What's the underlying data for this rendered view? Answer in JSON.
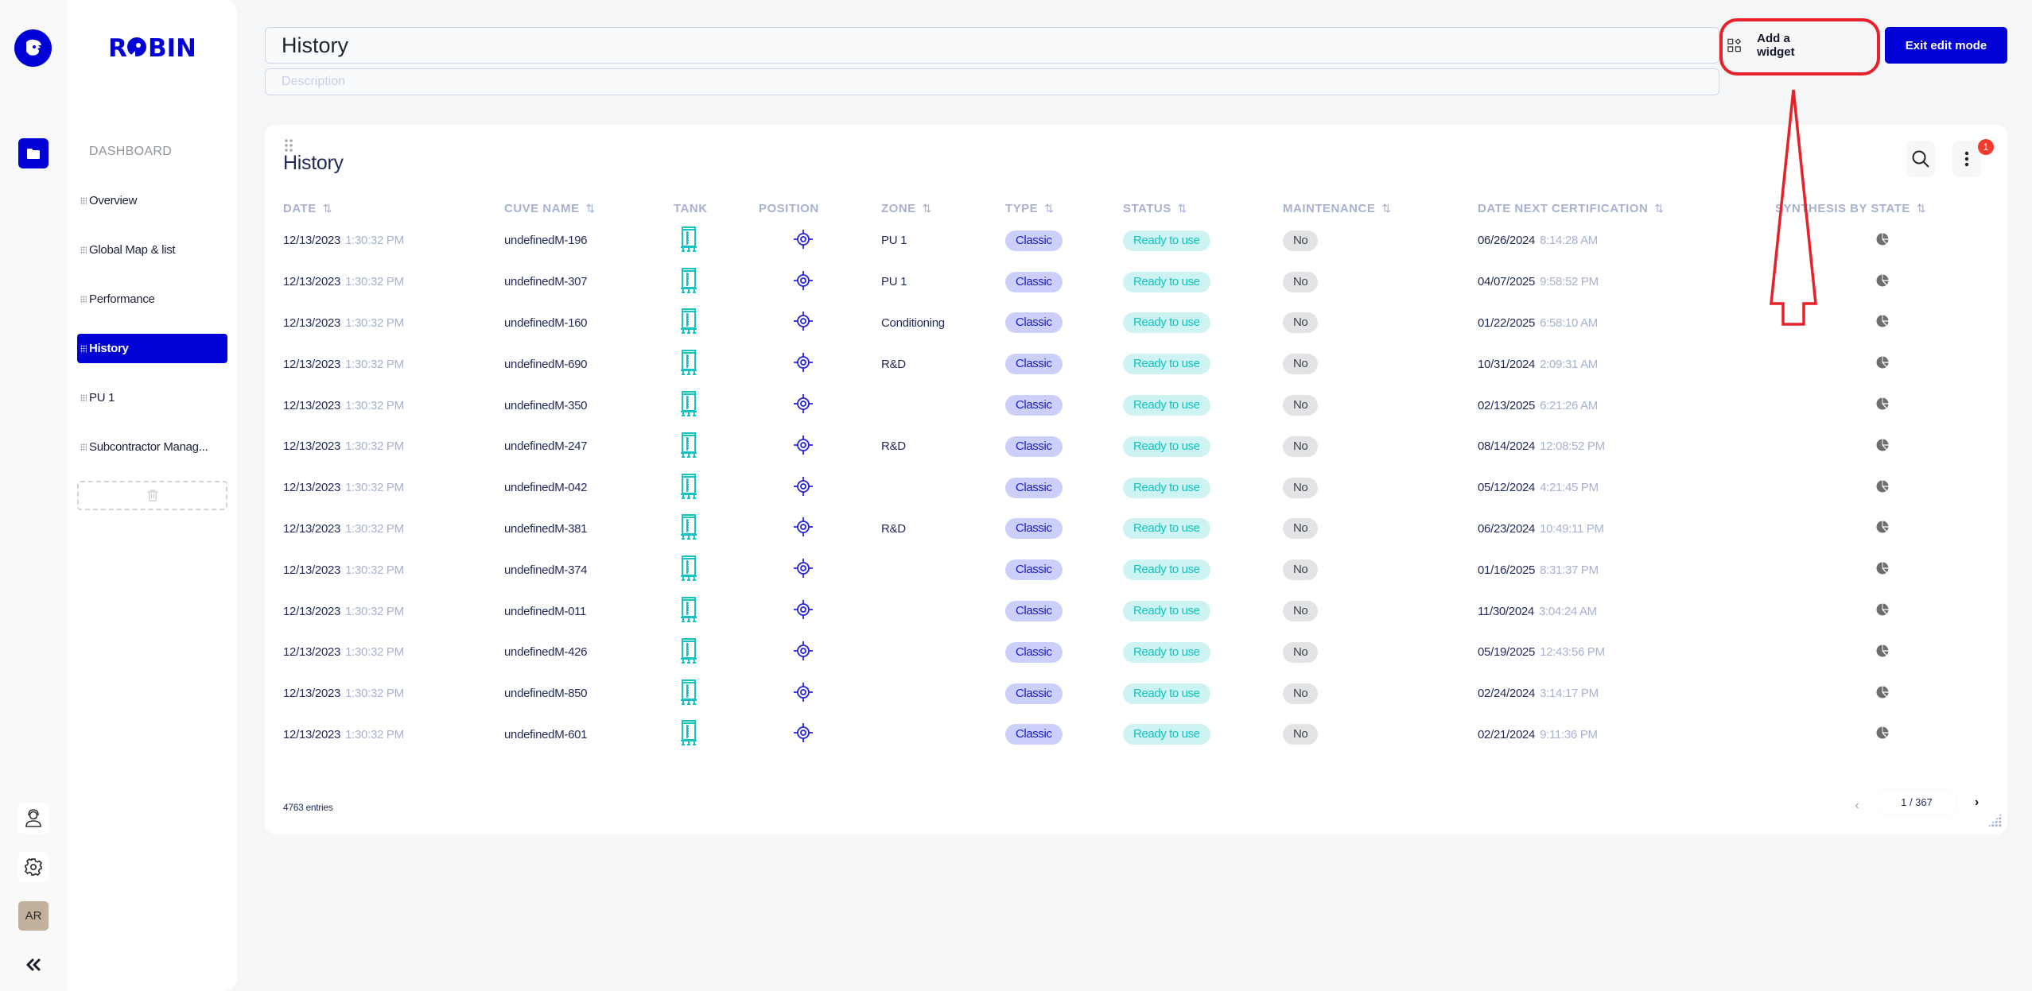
{
  "app": {
    "brand": "RCBIN",
    "brand_display": "R◐BIN",
    "section_label": "DASHBOARD",
    "avatar_initials": "AR",
    "colors": {
      "primary": "#0202d6",
      "teal": "#12c3c0",
      "alert": "#f43a2f",
      "annotation": "#e8202a"
    }
  },
  "rail": {
    "icons": [
      "robin-logo-icon",
      "folder-icon",
      "support-headset-icon",
      "gear-icon",
      "collapse-double-chevron-icon"
    ]
  },
  "nav": {
    "items": [
      {
        "label": "Overview",
        "active": false
      },
      {
        "label": "Global Map & list",
        "active": false
      },
      {
        "label": "Performance",
        "active": false
      },
      {
        "label": "History",
        "active": true
      },
      {
        "label": "PU 1",
        "active": false
      },
      {
        "label": "Subcontractor Manag...",
        "active": false
      }
    ],
    "drop_zone_icon": "trash-icon"
  },
  "header": {
    "title_value": "History",
    "description_placeholder": "Description",
    "add_widget_label": "Add a widget",
    "exit_edit_label": "Exit edit mode"
  },
  "widget": {
    "title": "History",
    "notification_count": "1",
    "columns": [
      {
        "label": "DATE",
        "sortable": true
      },
      {
        "label": "CUVE NAME",
        "sortable": true
      },
      {
        "label": "TANK",
        "sortable": false
      },
      {
        "label": "POSITION",
        "sortable": false
      },
      {
        "label": "ZONE",
        "sortable": true
      },
      {
        "label": "TYPE",
        "sortable": true
      },
      {
        "label": "STATUS",
        "sortable": true
      },
      {
        "label": "MAINTENANCE",
        "sortable": true
      },
      {
        "label": "DATE NEXT CERTIFICATION",
        "sortable": true
      },
      {
        "label": "SYNTHESIS BY STATE",
        "sortable": true
      }
    ],
    "sort_glyph": "⇅",
    "rows": [
      {
        "date": "12/13/2023",
        "time": "1:30:32 PM",
        "name": "undefinedM-196",
        "zone": "PU 1",
        "type": "Classic",
        "status": "Ready to use",
        "maintenance": "No",
        "cert_date": "06/26/2024",
        "cert_time": "8:14:28 AM"
      },
      {
        "date": "12/13/2023",
        "time": "1:30:32 PM",
        "name": "undefinedM-307",
        "zone": "PU 1",
        "type": "Classic",
        "status": "Ready to use",
        "maintenance": "No",
        "cert_date": "04/07/2025",
        "cert_time": "9:58:52 PM"
      },
      {
        "date": "12/13/2023",
        "time": "1:30:32 PM",
        "name": "undefinedM-160",
        "zone": "Conditioning",
        "type": "Classic",
        "status": "Ready to use",
        "maintenance": "No",
        "cert_date": "01/22/2025",
        "cert_time": "6:58:10 AM"
      },
      {
        "date": "12/13/2023",
        "time": "1:30:32 PM",
        "name": "undefinedM-690",
        "zone": "R&D",
        "type": "Classic",
        "status": "Ready to use",
        "maintenance": "No",
        "cert_date": "10/31/2024",
        "cert_time": "2:09:31 AM"
      },
      {
        "date": "12/13/2023",
        "time": "1:30:32 PM",
        "name": "undefinedM-350",
        "zone": "",
        "type": "Classic",
        "status": "Ready to use",
        "maintenance": "No",
        "cert_date": "02/13/2025",
        "cert_time": "6:21:26 AM"
      },
      {
        "date": "12/13/2023",
        "time": "1:30:32 PM",
        "name": "undefinedM-247",
        "zone": "R&D",
        "type": "Classic",
        "status": "Ready to use",
        "maintenance": "No",
        "cert_date": "08/14/2024",
        "cert_time": "12:08:52 PM"
      },
      {
        "date": "12/13/2023",
        "time": "1:30:32 PM",
        "name": "undefinedM-042",
        "zone": "",
        "type": "Classic",
        "status": "Ready to use",
        "maintenance": "No",
        "cert_date": "05/12/2024",
        "cert_time": "4:21:45 PM"
      },
      {
        "date": "12/13/2023",
        "time": "1:30:32 PM",
        "name": "undefinedM-381",
        "zone": "R&D",
        "type": "Classic",
        "status": "Ready to use",
        "maintenance": "No",
        "cert_date": "06/23/2024",
        "cert_time": "10:49:11 PM"
      },
      {
        "date": "12/13/2023",
        "time": "1:30:32 PM",
        "name": "undefinedM-374",
        "zone": "",
        "type": "Classic",
        "status": "Ready to use",
        "maintenance": "No",
        "cert_date": "01/16/2025",
        "cert_time": "8:31:37 PM"
      },
      {
        "date": "12/13/2023",
        "time": "1:30:32 PM",
        "name": "undefinedM-011",
        "zone": "",
        "type": "Classic",
        "status": "Ready to use",
        "maintenance": "No",
        "cert_date": "11/30/2024",
        "cert_time": "3:04:24 AM"
      },
      {
        "date": "12/13/2023",
        "time": "1:30:32 PM",
        "name": "undefinedM-426",
        "zone": "",
        "type": "Classic",
        "status": "Ready to use",
        "maintenance": "No",
        "cert_date": "05/19/2025",
        "cert_time": "12:43:56 PM"
      },
      {
        "date": "12/13/2023",
        "time": "1:30:32 PM",
        "name": "undefinedM-850",
        "zone": "",
        "type": "Classic",
        "status": "Ready to use",
        "maintenance": "No",
        "cert_date": "02/24/2024",
        "cert_time": "3:14:17 PM"
      },
      {
        "date": "12/13/2023",
        "time": "1:30:32 PM",
        "name": "undefinedM-601",
        "zone": "",
        "type": "Classic",
        "status": "Ready to use",
        "maintenance": "No",
        "cert_date": "02/21/2024",
        "cert_time": "9:11:36 PM"
      }
    ],
    "row_icons": {
      "tank": "tank-icon",
      "position": "crosshair-target-icon",
      "synthesis": "pie-chart-icon"
    },
    "entries_label": "4763 entries",
    "pagination": {
      "current_page": 1,
      "total_pages": 367,
      "display": "1 / 367",
      "prev_glyph": "‹",
      "next_glyph": "›"
    }
  },
  "annotation": {
    "highlight_target": "Add a widget",
    "shapes": [
      "ellipse-around-add-widget",
      "up-arrow-pointing-to-add-widget"
    ]
  }
}
